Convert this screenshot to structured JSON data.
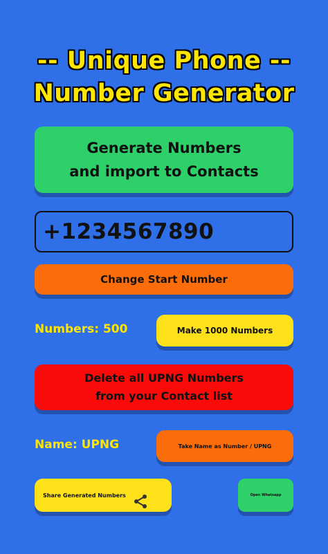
{
  "title": {
    "line1": "-- Unique Phone --",
    "line2": "Number Generator"
  },
  "buttons": {
    "generate": "Generate Numbers\nand import to Contacts",
    "change_start": "Change Start Number",
    "make_numbers": "Make 1000 Numbers",
    "delete": "Delete all UPNG Numbers\nfrom your Contact list",
    "take_name": "Take Name as Number / UPNG",
    "share": "Share Generated Numbers",
    "whatsapp": "Open Whatsapp"
  },
  "phone_field": {
    "value": "+1234567890"
  },
  "labels": {
    "numbers_count": "Numbers: 500",
    "name": "Name: UPNG"
  },
  "icons": {
    "share": "share-icon"
  },
  "colors": {
    "background": "#2f6fe8",
    "title_yellow": "#ffe600",
    "green": "#2ed06a",
    "orange": "#fb6d0a",
    "yellow": "#ffe11a",
    "red": "#fb0a0a"
  }
}
